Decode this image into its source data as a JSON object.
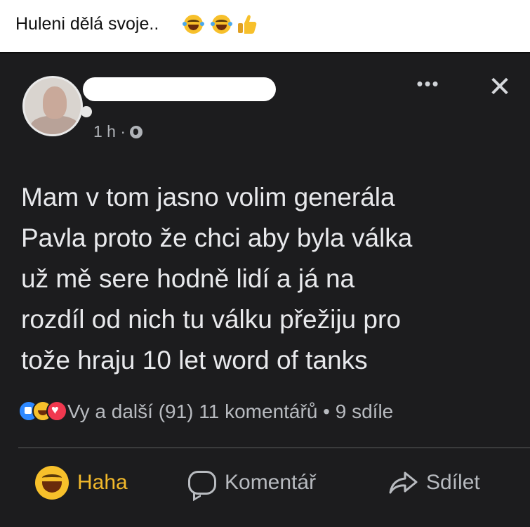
{
  "caption": {
    "text": "Huleni dělá svoje..",
    "emojis": [
      "tears-of-joy-icon",
      "tears-of-joy-icon",
      "thumbs-up-icon"
    ]
  },
  "post": {
    "time": "1 h ·",
    "text": "Mam v tom jasno volim generála\nPavla proto že chci aby byla válka\nuž mě sere hodně lidí a já na\nrozdíl od nich tu válku přežiju pro\ntože hraju 10 let word of tanks",
    "reaction_summary": "Vy a další (91) 11 komentářů • 9 sdíle",
    "reaction_icons": [
      "like-reaction-icon",
      "haha-reaction-icon",
      "love-reaction-icon"
    ]
  },
  "actions": {
    "haha_label": "Haha",
    "comment_label": "Komentář",
    "share_label": "Sdílet"
  },
  "colors": {
    "background_dark": "#1c1c1e",
    "text_primary": "#e8e9ec",
    "text_secondary": "#b8bbc0",
    "haha_accent": "#f2b92b"
  }
}
